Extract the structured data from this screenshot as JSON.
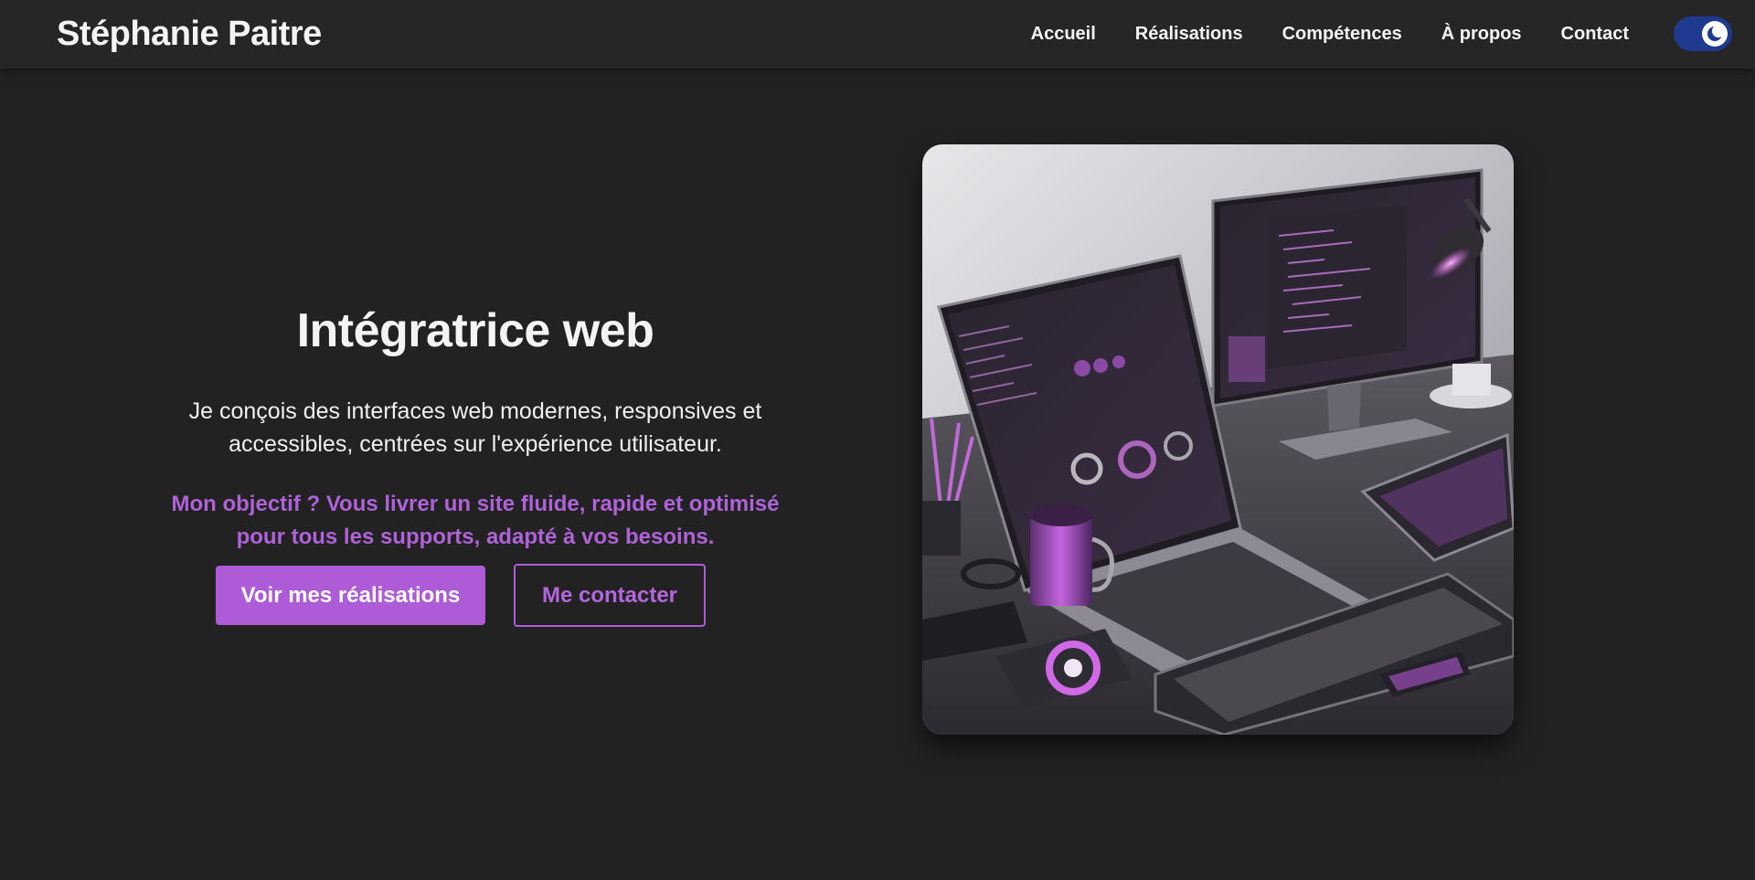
{
  "header": {
    "brand": "Stéphanie Paitre",
    "nav": [
      {
        "label": "Accueil"
      },
      {
        "label": "Réalisations"
      },
      {
        "label": "Compétences"
      },
      {
        "label": "À propos"
      },
      {
        "label": "Contact"
      }
    ],
    "theme_toggle": {
      "state": "dark",
      "icon": "moon-icon"
    }
  },
  "hero": {
    "title": "Intégratrice web",
    "description": "Je conçois des interfaces web modernes, responsives et accessibles, centrées sur l'expérience utilisateur.",
    "goal": "Mon objectif ? Vous livrer un site fluide, rapide et optimisé pour tous les supports, adapté à vos besoins.",
    "primary_button": "Voir mes réalisations",
    "secondary_button": "Me contacter",
    "image_alt": "Illustration of a developer desk with laptop, monitor and keyboard"
  },
  "colors": {
    "background": "#222223",
    "header": "#262626",
    "accent": "#ad5bd7",
    "toggle": "#1f3a8f"
  }
}
